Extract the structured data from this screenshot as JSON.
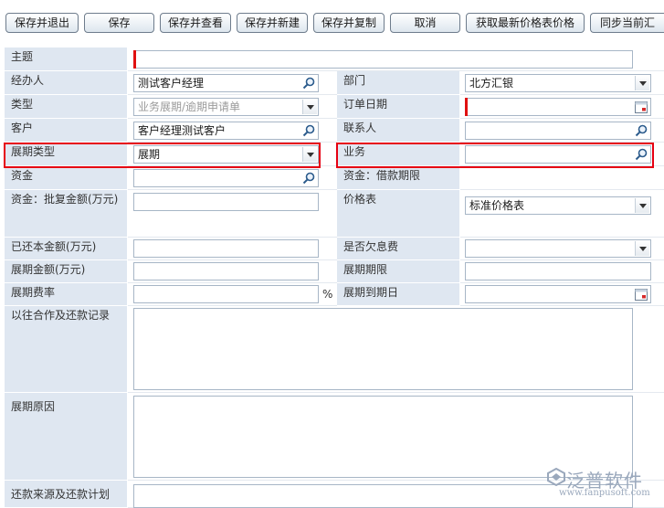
{
  "toolbar": {
    "buttons": [
      "保存并退出",
      "保存",
      "保存并查看",
      "保存并新建",
      "保存并复制",
      "取消",
      "获取最新价格表价格",
      "同步当前汇"
    ]
  },
  "form": {
    "subject": {
      "label": "主题",
      "value": ""
    },
    "handler": {
      "label": "经办人",
      "value": "测试客户经理"
    },
    "department": {
      "label": "部门",
      "value": "北方汇银"
    },
    "type": {
      "label": "类型",
      "placeholder": "业务展期/逾期申请单"
    },
    "order_date": {
      "label": "订单日期",
      "value": ""
    },
    "customer": {
      "label": "客户",
      "value": "客户经理测试客户"
    },
    "contact": {
      "label": "联系人",
      "value": ""
    },
    "extension_type": {
      "label": "展期类型",
      "value": "展期"
    },
    "business": {
      "label": "业务",
      "value": ""
    },
    "funds": {
      "label": "资金",
      "value": ""
    },
    "funds_loan_term": {
      "label": "资金：借款期限",
      "value": ""
    },
    "approved_amount": {
      "label": "资金：批复金额(万元)",
      "value": ""
    },
    "price_list": {
      "label": "价格表",
      "value": "标准价格表"
    },
    "repaid_principal": {
      "label": "已还本金额(万元)",
      "value": ""
    },
    "interest_owed": {
      "label": "是否欠息费",
      "value": ""
    },
    "extension_amount": {
      "label": "展期金额(万元)",
      "value": ""
    },
    "extension_term": {
      "label": "展期期限",
      "value": ""
    },
    "extension_rate": {
      "label": "展期费率",
      "value": "",
      "unit": "%"
    },
    "extension_due_date": {
      "label": "展期到期日",
      "value": ""
    },
    "history": {
      "label": "以往合作及还款记录",
      "value": ""
    },
    "reason": {
      "label": "展期原因",
      "value": ""
    },
    "repayment_plan": {
      "label": "还款来源及还款计划",
      "value": ""
    }
  },
  "logo": {
    "brand": "泛普软件",
    "url": "www.fanpusoft.com"
  },
  "colors": {
    "label_bg": "#dfe7f1",
    "highlight": "#e60012",
    "required": "#e01010",
    "border": "#a7b6c6"
  }
}
